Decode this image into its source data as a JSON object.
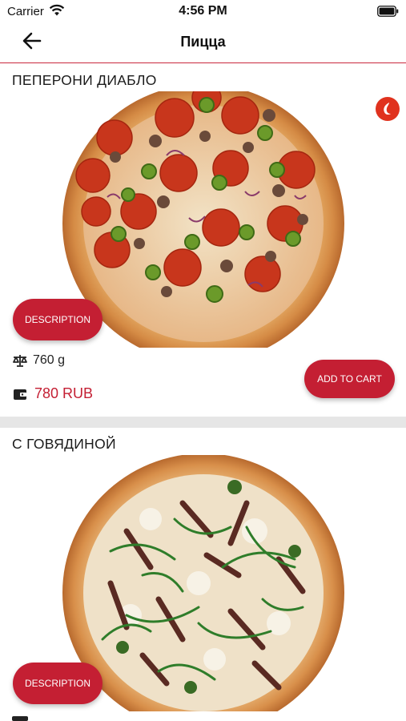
{
  "status_bar": {
    "carrier": "Carrier",
    "time": "4:56 PM",
    "wifi_icon": "wifi-icon",
    "battery_icon": "battery-icon"
  },
  "nav": {
    "title": "Пицца",
    "back_icon": "arrow-left-icon"
  },
  "colors": {
    "accent": "#c41f33",
    "nav_border": "#c9283e",
    "badge": "#e0321e",
    "divider": "#e6e6e6"
  },
  "products": [
    {
      "name": "ПЕПЕРОНИ ДИАБЛО",
      "description_label": "DESCRIPTION",
      "weight": "760 g",
      "price": "780 RUB",
      "add_to_cart_label": "ADD TO CART",
      "spicy_icon": "chili-icon",
      "weight_icon": "scale-icon",
      "price_icon": "wallet-icon"
    },
    {
      "name": "С ГОВЯДИНОЙ",
      "description_label": "DESCRIPTION"
    }
  ]
}
